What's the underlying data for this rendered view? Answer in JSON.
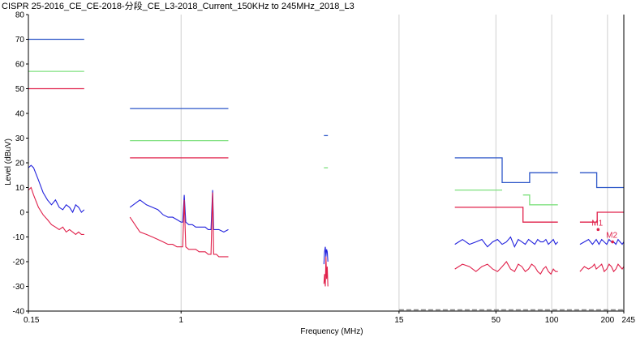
{
  "chart_data": {
    "type": "line",
    "title": "CISPR 25-2016_CE_CE-2018-分段_CE_L3-2018_Current_150KHz to 245MHz_2018_L3",
    "xlabel": "Frequency (MHz)",
    "ylabel": "Level (dBuV)",
    "xscale": "log",
    "xlim": [
      0.15,
      245
    ],
    "ylim": [
      -40,
      80
    ],
    "x_ticks": [
      0.15,
      1,
      15,
      50,
      100,
      200,
      245
    ],
    "x_tick_labels": [
      "0.15",
      "1",
      "15",
      "50",
      "100",
      "200",
      "245"
    ],
    "y_ticks": [
      -40,
      -30,
      -20,
      -10,
      0,
      10,
      20,
      30,
      40,
      50,
      60,
      70,
      80
    ],
    "y_tick_labels": [
      "-40",
      "-30",
      "-20",
      "-10",
      "0",
      "10",
      "20",
      "30",
      "40",
      "50",
      "60",
      "70",
      "80"
    ],
    "grid": false,
    "colors": {
      "peak_limit": "#2c56c8",
      "qp_limit": "#7ee07e",
      "avg_limit": "#e0204a",
      "peak_trace": "#2222dd",
      "avg_trace": "#e0204a",
      "vline": "#cfcfcf"
    },
    "vertical_lines": [
      1,
      15,
      50,
      100,
      200
    ],
    "limits": [
      {
        "color": "#2c56c8",
        "segments": [
          {
            "x": [
              0.15,
              0.3
            ],
            "y": [
              70,
              70
            ]
          },
          {
            "x": [
              0.53,
              1.8
            ],
            "y": [
              42,
              42
            ]
          },
          {
            "x": [
              5.9,
              6.2
            ],
            "y": [
              31,
              31
            ]
          },
          {
            "x": [
              30,
              54,
              54,
              76,
              76,
              108
            ],
            "y": [
              22,
              22,
              12,
              12,
              16,
              16
            ]
          },
          {
            "x": [
              142,
              175,
              175,
              245
            ],
            "y": [
              16,
              16,
              10,
              10
            ]
          }
        ]
      },
      {
        "color": "#7ee07e",
        "segments": [
          {
            "x": [
              0.15,
              0.3
            ],
            "y": [
              57,
              57
            ]
          },
          {
            "x": [
              0.53,
              1.8
            ],
            "y": [
              29,
              29
            ]
          },
          {
            "x": [
              5.9,
              6.2
            ],
            "y": [
              18,
              18
            ]
          },
          {
            "x": [
              30,
              54
            ],
            "y": [
              9,
              9
            ]
          },
          {
            "x": [
              70,
              76,
              76,
              108
            ],
            "y": [
              7,
              7,
              3,
              3
            ]
          }
        ]
      },
      {
        "color": "#e0204a",
        "segments": [
          {
            "x": [
              0.15,
              0.3
            ],
            "y": [
              50,
              50
            ]
          },
          {
            "x": [
              0.53,
              1.8
            ],
            "y": [
              22,
              22
            ]
          },
          {
            "x": [
              30,
              70,
              70,
              108
            ],
            "y": [
              2,
              2,
              -4,
              -4
            ]
          },
          {
            "x": [
              142,
              175
            ],
            "y": [
              -4,
              -4
            ]
          },
          {
            "x": [
              175,
              176,
              176,
              245
            ],
            "y": [
              -4,
              -4,
              0,
              0
            ]
          }
        ]
      }
    ],
    "series": [
      {
        "color": "#2222dd",
        "segments": [
          {
            "x": [
              0.15,
              0.155,
              0.16,
              0.17,
              0.18,
              0.19,
              0.2,
              0.21,
              0.22,
              0.23,
              0.24,
              0.25,
              0.26,
              0.27,
              0.28,
              0.29,
              0.3
            ],
            "y": [
              18,
              19,
              18,
              13,
              8,
              5,
              3,
              5,
              2,
              1,
              3,
              2,
              0,
              3,
              2,
              0,
              1
            ]
          },
          {
            "x": [
              0.53,
              0.6,
              0.65,
              0.7,
              0.75,
              0.8,
              0.85,
              0.9,
              0.95,
              1.0,
              1.02,
              1.04,
              1.06,
              1.1,
              1.15,
              1.2,
              1.25,
              1.3,
              1.35,
              1.4,
              1.45,
              1.48,
              1.5,
              1.55,
              1.6,
              1.7,
              1.8
            ],
            "y": [
              2,
              5,
              3,
              2,
              1,
              -1,
              -2,
              -2,
              -3,
              -4,
              -4,
              7,
              -4,
              -5,
              -5,
              -6,
              -6,
              -6,
              -6,
              -7,
              -7,
              9,
              -7,
              -7,
              -7,
              -8,
              -7
            ]
          },
          {
            "x": [
              5.9,
              5.95,
              6.0,
              6.05,
              6.1,
              6.15,
              6.2
            ],
            "y": [
              -21,
              -16,
              -14,
              -18,
              -15,
              -16,
              -20
            ]
          },
          {
            "x": [
              30,
              33,
              36,
              39,
              42,
              45,
              48,
              51,
              54,
              57,
              60,
              63,
              66,
              69,
              72,
              75,
              78,
              81,
              84,
              87,
              90,
              93,
              96,
              99,
              102,
              105,
              108
            ],
            "y": [
              -13,
              -11,
              -13,
              -12,
              -11,
              -14,
              -12,
              -11,
              -13,
              -12,
              -10,
              -14,
              -11,
              -12,
              -13,
              -11,
              -12,
              -13,
              -11,
              -12,
              -12,
              -11,
              -13,
              -12,
              -11,
              -13,
              -12
            ]
          },
          {
            "x": [
              142,
              150,
              158,
              166,
              170,
              174,
              180,
              186,
              192,
              198,
              204,
              210,
              216,
              222,
              228,
              234,
              240,
              245
            ],
            "y": [
              -13,
              -12,
              -11,
              -13,
              -12,
              -11,
              -13,
              -11,
              -12,
              -13,
              -11,
              -12,
              -12,
              -13,
              -11,
              -12,
              -13,
              -12
            ]
          }
        ]
      },
      {
        "color": "#e0204a",
        "segments": [
          {
            "x": [
              0.15,
              0.155,
              0.16,
              0.17,
              0.18,
              0.19,
              0.2,
              0.21,
              0.22,
              0.23,
              0.24,
              0.25,
              0.26,
              0.27,
              0.28,
              0.29,
              0.3
            ],
            "y": [
              9,
              10,
              7,
              2,
              -1,
              -3,
              -5,
              -6,
              -7,
              -6,
              -8,
              -7,
              -8,
              -9,
              -8,
              -9,
              -9
            ]
          },
          {
            "x": [
              0.53,
              0.6,
              0.65,
              0.7,
              0.75,
              0.8,
              0.85,
              0.9,
              0.95,
              1.0,
              1.02,
              1.04,
              1.06,
              1.1,
              1.15,
              1.2,
              1.25,
              1.3,
              1.35,
              1.4,
              1.45,
              1.48,
              1.5,
              1.55,
              1.6,
              1.7,
              1.8
            ],
            "y": [
              -2,
              -8,
              -9,
              -10,
              -11,
              -12,
              -13,
              -13,
              -14,
              -14,
              -14,
              5,
              -14,
              -15,
              -15,
              -15,
              -16,
              -16,
              -16,
              -17,
              -17,
              8,
              -17,
              -17,
              -18,
              -18,
              -18
            ]
          },
          {
            "x": [
              5.9,
              5.95,
              6.0,
              6.05,
              6.1,
              6.15,
              6.2
            ],
            "y": [
              -29,
              -25,
              -30,
              -18,
              -27,
              -22,
              -30
            ]
          },
          {
            "x": [
              30,
              33,
              36,
              39,
              42,
              45,
              48,
              51,
              54,
              57,
              60,
              63,
              66,
              69,
              72,
              75,
              78,
              81,
              84,
              87,
              90,
              93,
              96,
              99,
              102,
              105,
              108
            ],
            "y": [
              -23,
              -21,
              -22,
              -24,
              -22,
              -21,
              -23,
              -24,
              -22,
              -20,
              -23,
              -24,
              -21,
              -22,
              -24,
              -23,
              -21,
              -22,
              -24,
              -25,
              -23,
              -22,
              -24,
              -25,
              -23,
              -24,
              -24
            ]
          },
          {
            "x": [
              142,
              150,
              158,
              166,
              170,
              174,
              180,
              186,
              192,
              198,
              204,
              210,
              216,
              222,
              228,
              234,
              240,
              245
            ],
            "y": [
              -24,
              -22,
              -23,
              -22,
              -21,
              -23,
              -22,
              -21,
              -24,
              -23,
              -21,
              -22,
              -24,
              -23,
              -21,
              -22,
              -23,
              -22
            ]
          }
        ]
      }
    ],
    "floor": {
      "color": "#888888",
      "x": [
        15,
        245
      ],
      "y": [
        -39.5,
        -39.5
      ]
    },
    "markers": [
      {
        "label": "M1",
        "x": 178,
        "y": -7
      },
      {
        "label": "M2",
        "x": 213,
        "y": -12
      }
    ]
  }
}
